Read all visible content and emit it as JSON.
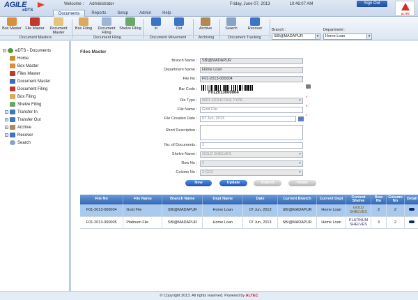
{
  "header": {
    "logo_top": "AGILE",
    "logo_sub": "eDTS",
    "welcome_label": "Welcome :",
    "user": "Administrator",
    "date": "Friday, June 07, 2013",
    "time": "10:46:07 AM",
    "signout": "Sign Out",
    "corner_logo": "ALTEC",
    "tabs": [
      "Documents",
      "Reports",
      "Setup",
      "Admin",
      "Help"
    ]
  },
  "ribbon": {
    "buttons": {
      "box_master": "Box Master",
      "file_master": "File Master",
      "document_master": "Document Master",
      "box_filing": "Box Filing",
      "document_filing": "Document Filing",
      "shelve_filing": "Shelve Filing",
      "in": "In",
      "out": "Out",
      "archive": "Archive",
      "search": "Search",
      "recover": "Recover"
    },
    "groups": {
      "masters": "Document Masters",
      "filing": "Document Filing",
      "movement": "Document Movement",
      "archiving": "Archiving",
      "tracking": "Document Tracking"
    },
    "branch_label": "Branch :",
    "branch_value": "SBI@MADAPUR",
    "department_label": "Department :",
    "department_value": "Home Loan"
  },
  "sidebar": {
    "root": "eDTS - Documents",
    "items": [
      "Home",
      "Box Master",
      "Files Master",
      "Document Master",
      "Document Filing",
      "Box Filing",
      "Shelve Filing",
      "Transfer In",
      "Transfer Out",
      "Archive",
      "Recover",
      "Search"
    ]
  },
  "form": {
    "title": "Files Master",
    "branch_name_label": "Branch Name :",
    "branch_name": "SBI@MADAPUR",
    "department_name_label": "Department Name :",
    "department_name": "Home Loan",
    "file_no_label": "File No :",
    "file_no": "F01-2013-000004",
    "bar_code_label": "Bar Code :",
    "bar_code_text": "F012013000004",
    "file_type_label": "File Type :",
    "file_type": "0001-GOLD FILE TYPE",
    "file_name_label": "File Name :",
    "file_name": "Gold File",
    "file_creation_date_label": "File Creation Date :",
    "file_creation_date": "07 Jun, 2013",
    "short_description_label": "Short Description :",
    "short_description": "",
    "no_of_documents_label": "No. of Documents :",
    "no_of_documents": "1",
    "shelve_name_label": "Shelve Name :",
    "shelve_name": "GOLD SHELVES",
    "row_no_label": "Row No :",
    "row_no": "2",
    "column_no_label": "Column No :",
    "column_no": "2-GC2",
    "buttons": {
      "new": "New",
      "update": "Update",
      "submit": "Submit",
      "reset": "Reset"
    }
  },
  "table": {
    "headers": [
      "File No",
      "File Name",
      "Branch Name",
      "Dept Name",
      "Date",
      "Current Branch",
      "Current Dept",
      "Current Shelve",
      "Row No",
      "Column No",
      "Detail"
    ],
    "rows": [
      [
        "F01-2013-000004",
        "Gold File",
        "SBI@MADAPUR",
        "Home Loan",
        "07 Jun, 2013",
        "SBI@MADAPUR",
        "Home Loan",
        "GOLD SHELVES",
        "2",
        "2"
      ],
      [
        "F01-2013-000005",
        "Platinum File",
        "SBI@MADAPUR",
        "Home Loan",
        "07 Jun, 2013",
        "SBI@MADAPUR",
        "Home Loan",
        "PLATINUM SHELVES",
        "3",
        "2"
      ]
    ]
  },
  "footer": {
    "text": "© Copyright 2013. All rights reserved. Powered by",
    "brand": "ALTEC"
  },
  "colors": {
    "accent": "#1d55b8",
    "selected_row": "#a9c9ee",
    "header_blue": "#3568b3"
  }
}
